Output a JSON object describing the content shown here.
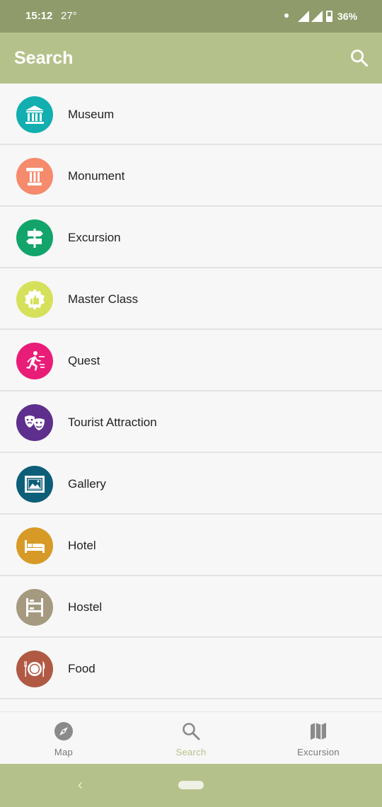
{
  "status_bar": {
    "time": "15:12",
    "temperature": "27°",
    "battery": "36%"
  },
  "header": {
    "title": "Search",
    "search_icon": "search-icon"
  },
  "categories": [
    {
      "label": "Museum",
      "icon": "museum-icon",
      "color": "#12aeb0"
    },
    {
      "label": "Monument",
      "icon": "monument-icon",
      "color": "#f58a6c"
    },
    {
      "label": "Excursion",
      "icon": "signpost-icon",
      "color": "#13a46b"
    },
    {
      "label": "Master Class",
      "icon": "thumbs-up-badge-icon",
      "color": "#d6e15b"
    },
    {
      "label": "Quest",
      "icon": "running-man-icon",
      "color": "#e91d77"
    },
    {
      "label": "Tourist Attraction",
      "icon": "theater-masks-icon",
      "color": "#5e2f8d"
    },
    {
      "label": "Gallery",
      "icon": "picture-frame-icon",
      "color": "#0d5e78"
    },
    {
      "label": "Hotel",
      "icon": "bed-icon",
      "color": "#d79a26"
    },
    {
      "label": "Hostel",
      "icon": "bunk-bed-icon",
      "color": "#a59a80"
    },
    {
      "label": "Food",
      "icon": "plate-cutlery-icon",
      "color": "#b05a44"
    }
  ],
  "bottom_nav": {
    "items": [
      {
        "label": "Map",
        "icon": "compass-icon"
      },
      {
        "label": "Search",
        "icon": "search-icon"
      },
      {
        "label": "Excursion",
        "icon": "map-icon"
      }
    ],
    "active": "Search",
    "active_color": "#b5c18a"
  },
  "colors": {
    "toolbar": "#b5c18a",
    "status_bar": "#8f9b6a"
  }
}
